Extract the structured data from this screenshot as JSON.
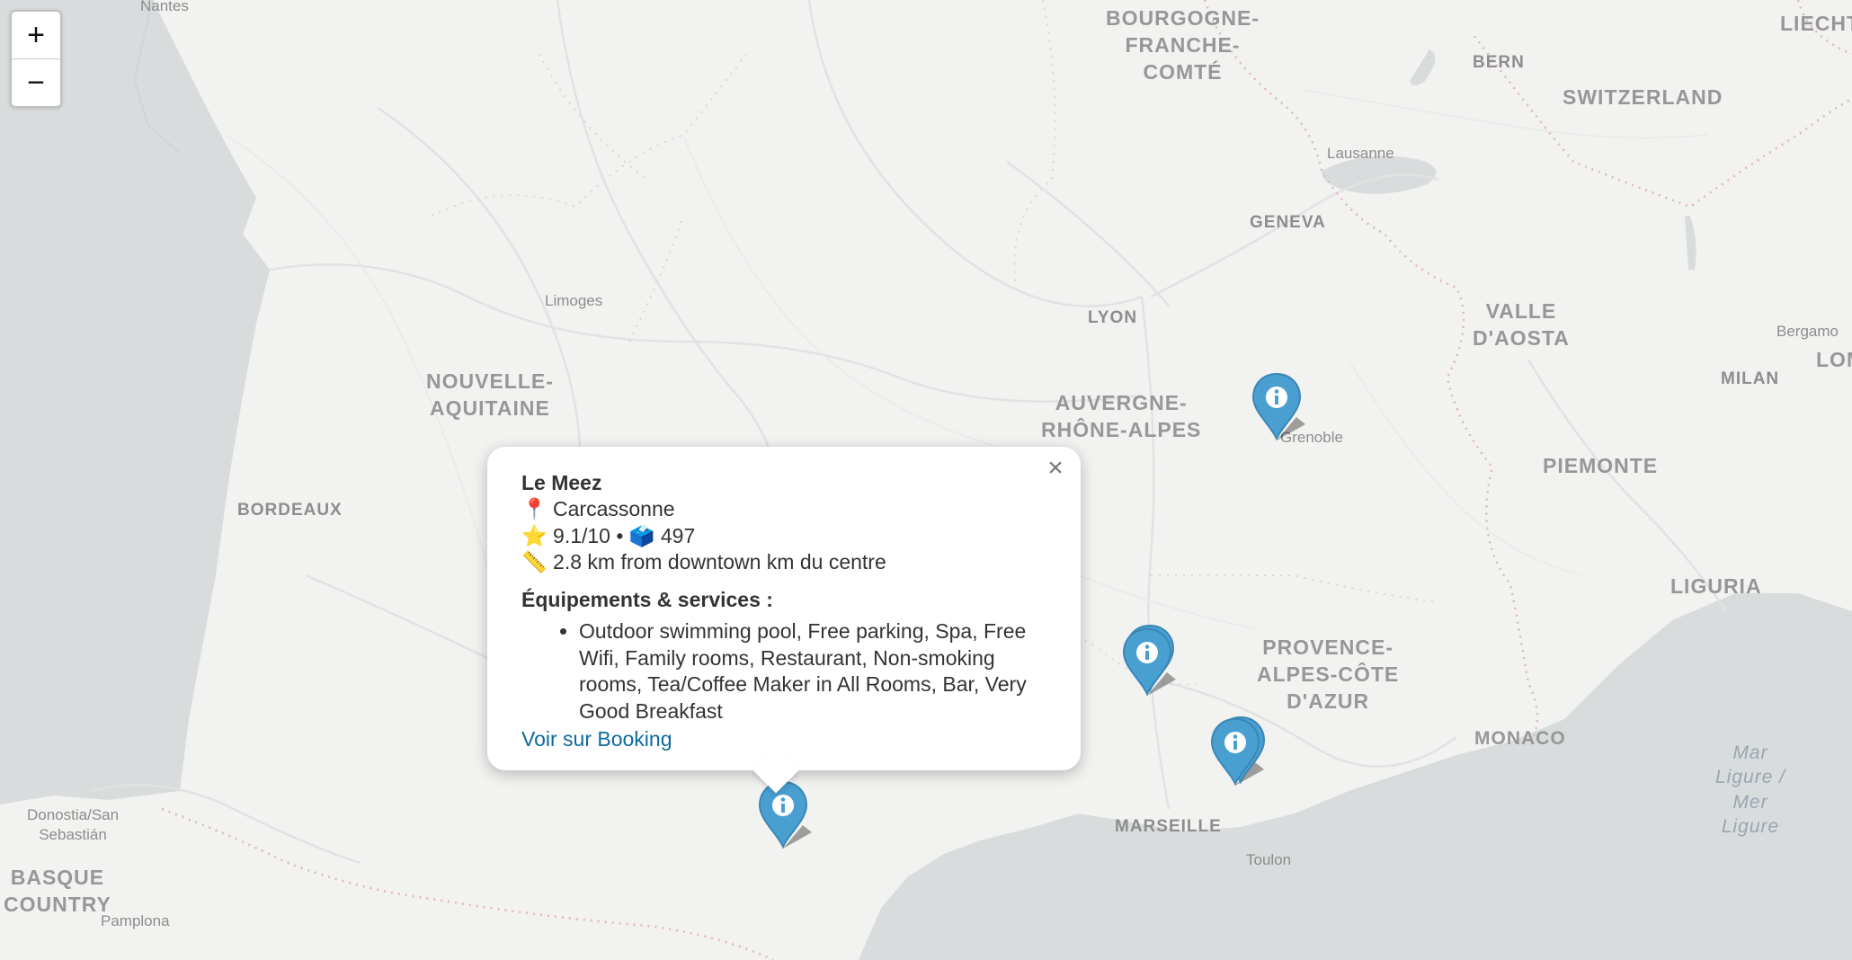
{
  "map": {
    "labels": {
      "regions": {
        "bourgogne": [
          "BOURGOGNE-",
          "FRANCHE-",
          "COMTÉ"
        ],
        "nouvelle_aquitaine": [
          "NOUVELLE-",
          "AQUITAINE"
        ],
        "auvergne": [
          "AUVERGNE-",
          "RHÔNE-ALPES"
        ],
        "provence": [
          "PROVENCE-",
          "ALPES-CÔTE",
          "D'AZUR"
        ],
        "valle_daosta": [
          "VALLE",
          "D'AOSTA"
        ],
        "piemonte": "PIEMONTE",
        "liguria": "LIGURIA",
        "switzerland": "SWITZERLAND",
        "basque_country": [
          "BASQUE",
          "COUNTRY"
        ],
        "liechtenstein": "LIECHTEN",
        "lombardy": "LOM"
      },
      "cities": {
        "nantes": "Nantes",
        "bern": "BERN",
        "lausanne": "Lausanne",
        "geneva": "GENEVA",
        "limoges": "Limoges",
        "lyon": "LYON",
        "milan": "MILAN",
        "bergamo": "Bergamo",
        "grenoble": "Grenoble",
        "bordeaux": "BORDEAUX",
        "donostia": [
          "Donostia/San",
          "Sebastián"
        ],
        "pamplona": "Pamplona",
        "marseille": "MARSEILLE",
        "toulon": "Toulon",
        "monaco": "MONACO"
      },
      "sea": [
        "Mar",
        "Ligure /",
        "Mer",
        "Ligure"
      ]
    },
    "zoom": {
      "in_label": "+",
      "out_label": "−"
    },
    "marker_icon": "info-marker-icon",
    "marker_color": "#4a9fd1"
  },
  "popup": {
    "title": "Le Meez",
    "location_icon": "📍",
    "location": "Carcassonne",
    "rating_icon": "⭐",
    "rating": "9.1/10",
    "separator": "•",
    "reviews_icon": "🗳️",
    "reviews": "497",
    "distance_icon": "📏",
    "distance": "2.8 km from downtown km du centre",
    "services_heading": "Équipements & services :",
    "services": "Outdoor swimming pool, Free parking, Spa, Free Wifi, Family rooms, Restaurant, Non-smoking rooms, Tea/Coffee Maker in All Rooms, Bar, Very Good Breakfast",
    "link_label": "Voir sur Booking",
    "close_label": "×"
  }
}
